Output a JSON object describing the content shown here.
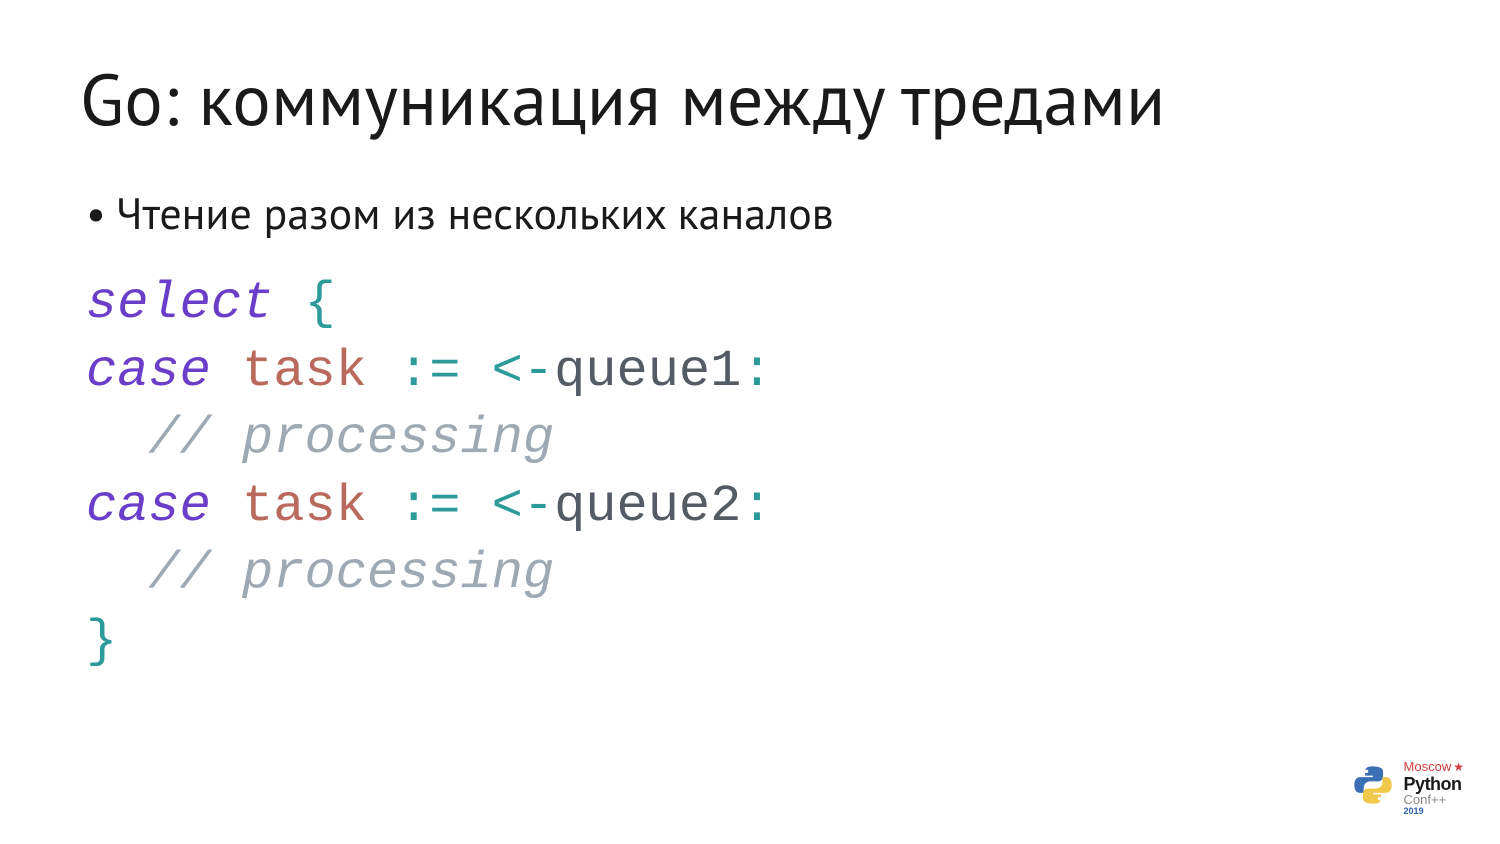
{
  "title": "Go: коммуникация между тредами",
  "bullet": "Чтение разом из нескольких каналов",
  "code": {
    "l1_select": "select ",
    "l1_brace": "{",
    "l2_case": "case ",
    "l2_task": "task ",
    "l2_op": ":= <-",
    "l2_queue": "queue1",
    "l2_colon": ":",
    "l3_indent": "  ",
    "l3_comment": "// processing",
    "l4_case": "case ",
    "l4_task": "task ",
    "l4_op": ":= <-",
    "l4_queue": "queue2",
    "l4_colon": ":",
    "l5_indent": "  ",
    "l5_comment": "// processing",
    "l6_brace": "}"
  },
  "logo": {
    "line1": "Moscow",
    "line2": "Python",
    "line3": "Conf++",
    "year": "2019",
    "star": "★"
  }
}
